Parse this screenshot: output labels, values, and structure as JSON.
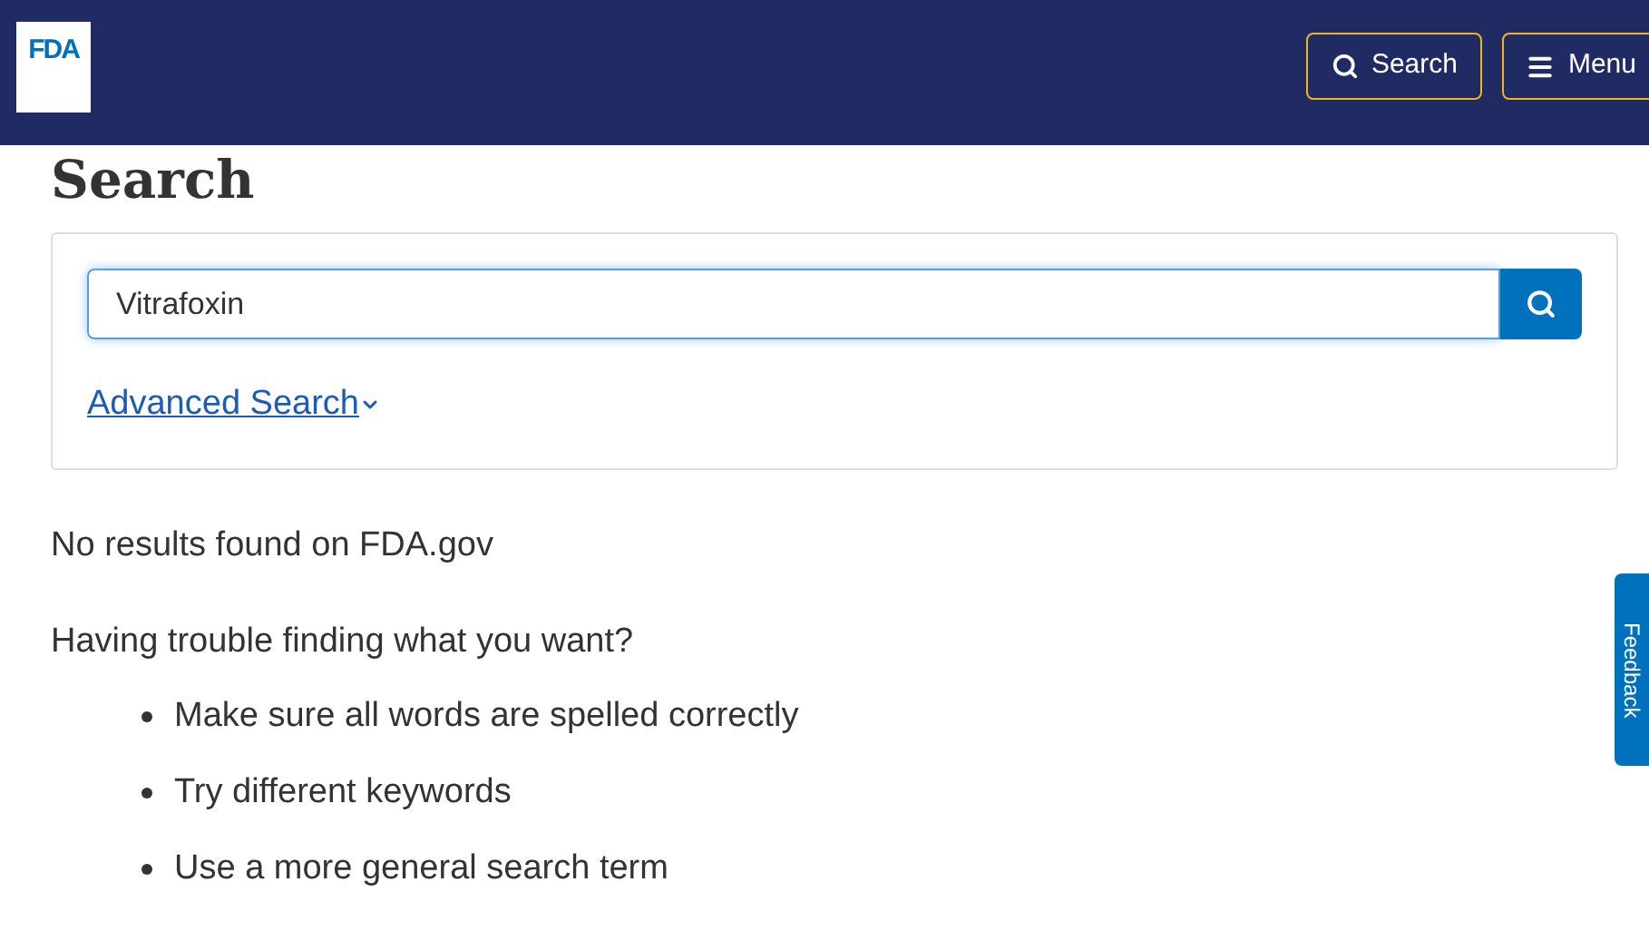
{
  "header": {
    "logo": "FDA",
    "search_button": "Search",
    "menu_button": "Menu"
  },
  "page_title": "Search",
  "search": {
    "value": "Vitrafoxin",
    "advanced_link": "Advanced Search"
  },
  "results_message": "No results found on FDA.gov",
  "help_heading": "Having trouble finding what you want?",
  "tips": [
    "Make sure all words are spelled correctly",
    "Try different keywords",
    "Use a more general search term"
  ],
  "feedback_tab": "Feedback"
}
